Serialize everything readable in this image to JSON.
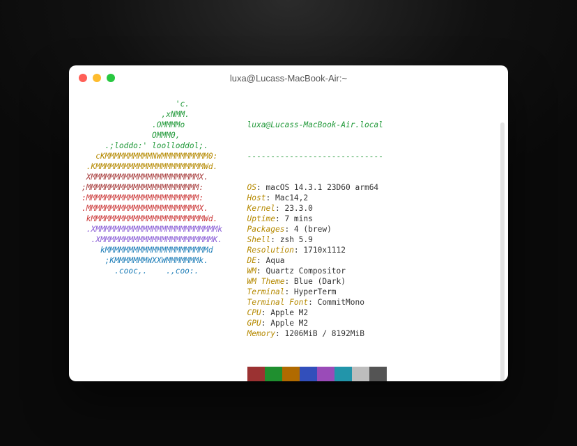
{
  "window": {
    "title": "luxa@Lucass-MacBook-Air:~"
  },
  "ascii": [
    {
      "cls": "g",
      "text": "                    'c.         "
    },
    {
      "cls": "g",
      "text": "                 ,xNMM.         "
    },
    {
      "cls": "g",
      "text": "               .OMMMMo          "
    },
    {
      "cls": "g",
      "text": "               OMMM0,           "
    },
    {
      "cls": "g",
      "text": "     .;loddo:' loolloddol;.     "
    },
    {
      "cls": "y",
      "text": "   cKMMMMMMMMMMNWMMMMMMMMMM0:   "
    },
    {
      "cls": "y",
      "text": " .KMMMMMMMMMMMMMMMMMMMMMMMWd.   "
    },
    {
      "cls": "br",
      "text": " XMMMMMMMMMMMMMMMMMMMMMMMX.     "
    },
    {
      "cls": "br",
      "text": ";MMMMMMMMMMMMMMMMMMMMMMMM:      "
    },
    {
      "cls": "r",
      "text": ":MMMMMMMMMMMMMMMMMMMMMMMM:      "
    },
    {
      "cls": "r",
      "text": ".MMMMMMMMMMMMMMMMMMMMMMMMX.     "
    },
    {
      "cls": "r",
      "text": " kMMMMMMMMMMMMMMMMMMMMMMMMWd.   "
    },
    {
      "cls": "p",
      "text": " .XMMMMMMMMMMMMMMMMMMMMMMMMMMk  "
    },
    {
      "cls": "p",
      "text": "  .XMMMMMMMMMMMMMMMMMMMMMMMMK.  "
    },
    {
      "cls": "b",
      "text": "    kMMMMMMMMMMMMMMMMMMMMMMd    "
    },
    {
      "cls": "b",
      "text": "     ;KMMMMMMMWXXWMMMMMMMk.     "
    },
    {
      "cls": "b",
      "text": "       .cooc,.    .,coo:.       "
    }
  ],
  "neofetch": {
    "user": "luxa",
    "at": "@",
    "host": "Lucass-MacBook-Air.local",
    "dashes": "-----------------------------",
    "rows": [
      {
        "k": "OS",
        "v": "macOS 14.3.1 23D60 arm64"
      },
      {
        "k": "Host",
        "v": "Mac14,2"
      },
      {
        "k": "Kernel",
        "v": "23.3.0"
      },
      {
        "k": "Uptime",
        "v": "7 mins"
      },
      {
        "k": "Packages",
        "v": "4 (brew)"
      },
      {
        "k": "Shell",
        "v": "zsh 5.9"
      },
      {
        "k": "Resolution",
        "v": "1710x1112"
      },
      {
        "k": "DE",
        "v": "Aqua"
      },
      {
        "k": "WM",
        "v": "Quartz Compositor"
      },
      {
        "k": "WM Theme",
        "v": "Blue (Dark)"
      },
      {
        "k": "Terminal",
        "v": "HyperTerm"
      },
      {
        "k": "Terminal Font",
        "v": "CommitMono"
      },
      {
        "k": "CPU",
        "v": "Apple M2"
      },
      {
        "k": "GPU",
        "v": "Apple M2"
      },
      {
        "k": "Memory",
        "v": "1206MiB / 8192MiB"
      }
    ],
    "swatches": [
      "#9b3232",
      "#1f8f2f",
      "#b06a00",
      "#324fbb",
      "#9a4bb8",
      "#2295aa",
      "#bdbdbd",
      "#545454"
    ]
  },
  "prompt": {
    "arrow": "→",
    "tilde": "~"
  }
}
